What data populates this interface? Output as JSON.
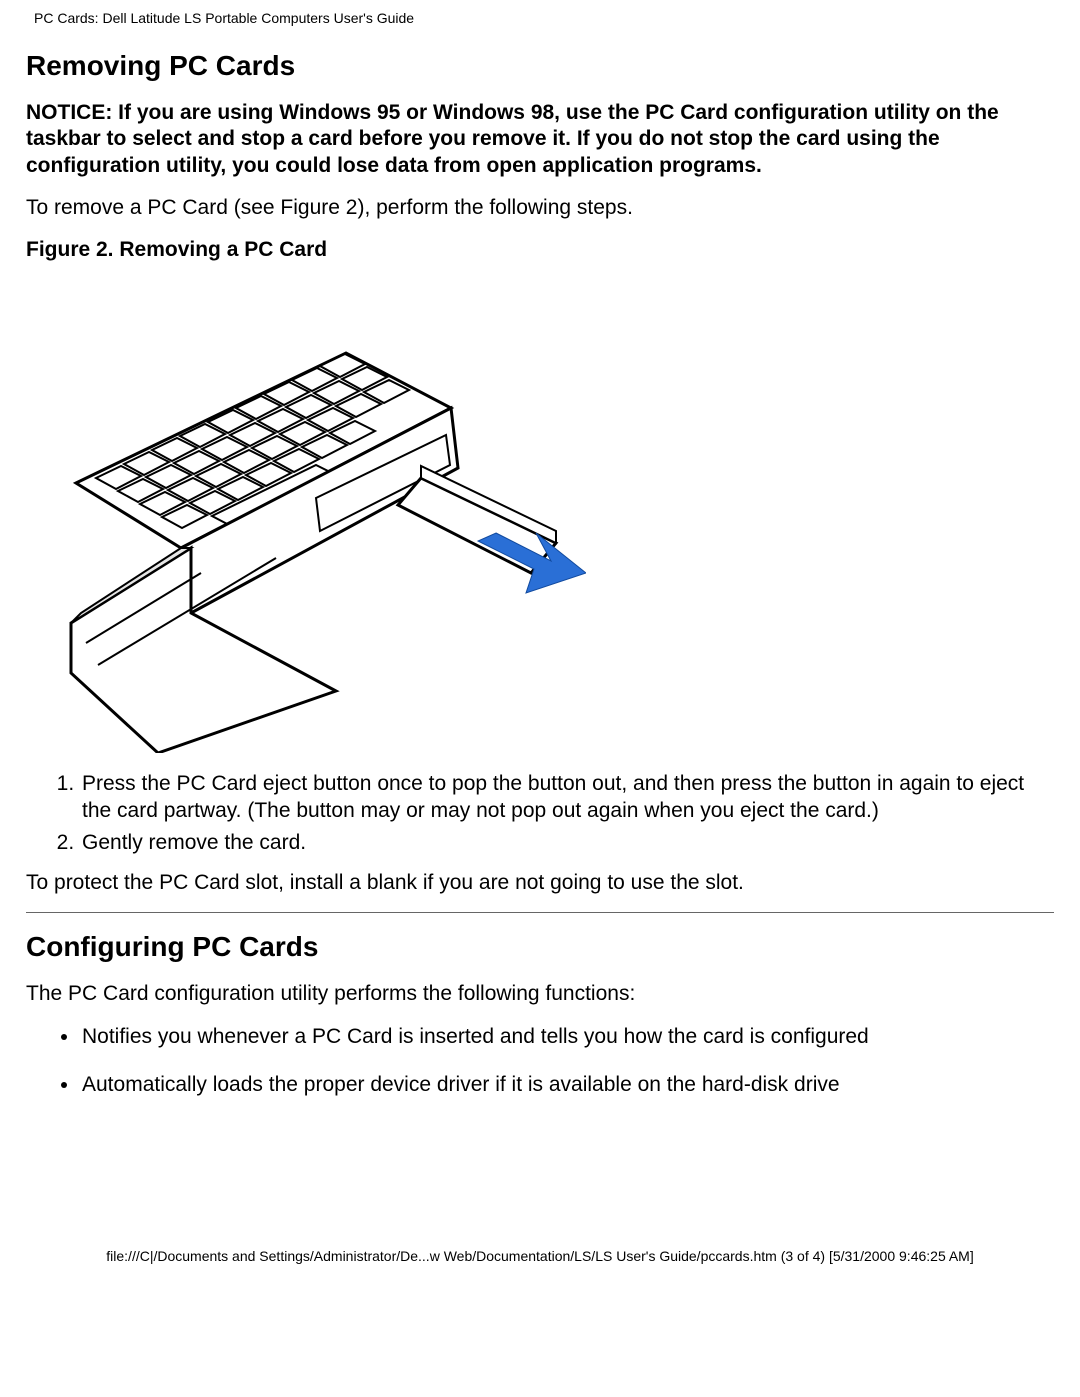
{
  "header": {
    "title": "PC Cards: Dell Latitude LS Portable Computers User's Guide"
  },
  "section_removing": {
    "heading": "Removing PC Cards",
    "notice": "NOTICE: If you are using Windows 95 or Windows 98, use the PC Card configuration utility on the taskbar to select and stop a card before you remove it. If you do not stop the card using the configuration utility, you could lose data from open application programs.",
    "intro": "To remove a PC Card  (see Figure 2), perform the following steps.",
    "figure_caption": "Figure 2. Removing a PC Card",
    "steps": [
      "Press the PC Card eject button once to pop the button out, and then press the button in again to eject the card partway. (The button may or may not pop out again when you eject the card.)",
      "Gently remove the card."
    ],
    "protect": "To protect the PC Card slot, install a blank if you are not going to use the slot."
  },
  "section_config": {
    "heading": "Configuring PC Cards",
    "intro": "The PC Card configuration utility performs the following functions:",
    "bullets": [
      "Notifies you whenever a PC Card is inserted and tells you how the card is configured",
      "Automatically loads the proper device driver if it is available on the hard-disk drive"
    ]
  },
  "footer": {
    "text": "file:///C|/Documents and Settings/Administrator/De...w Web/Documentation/LS/LS User's Guide/pccards.htm (3 of 4) [5/31/2000 9:46:25 AM]"
  }
}
